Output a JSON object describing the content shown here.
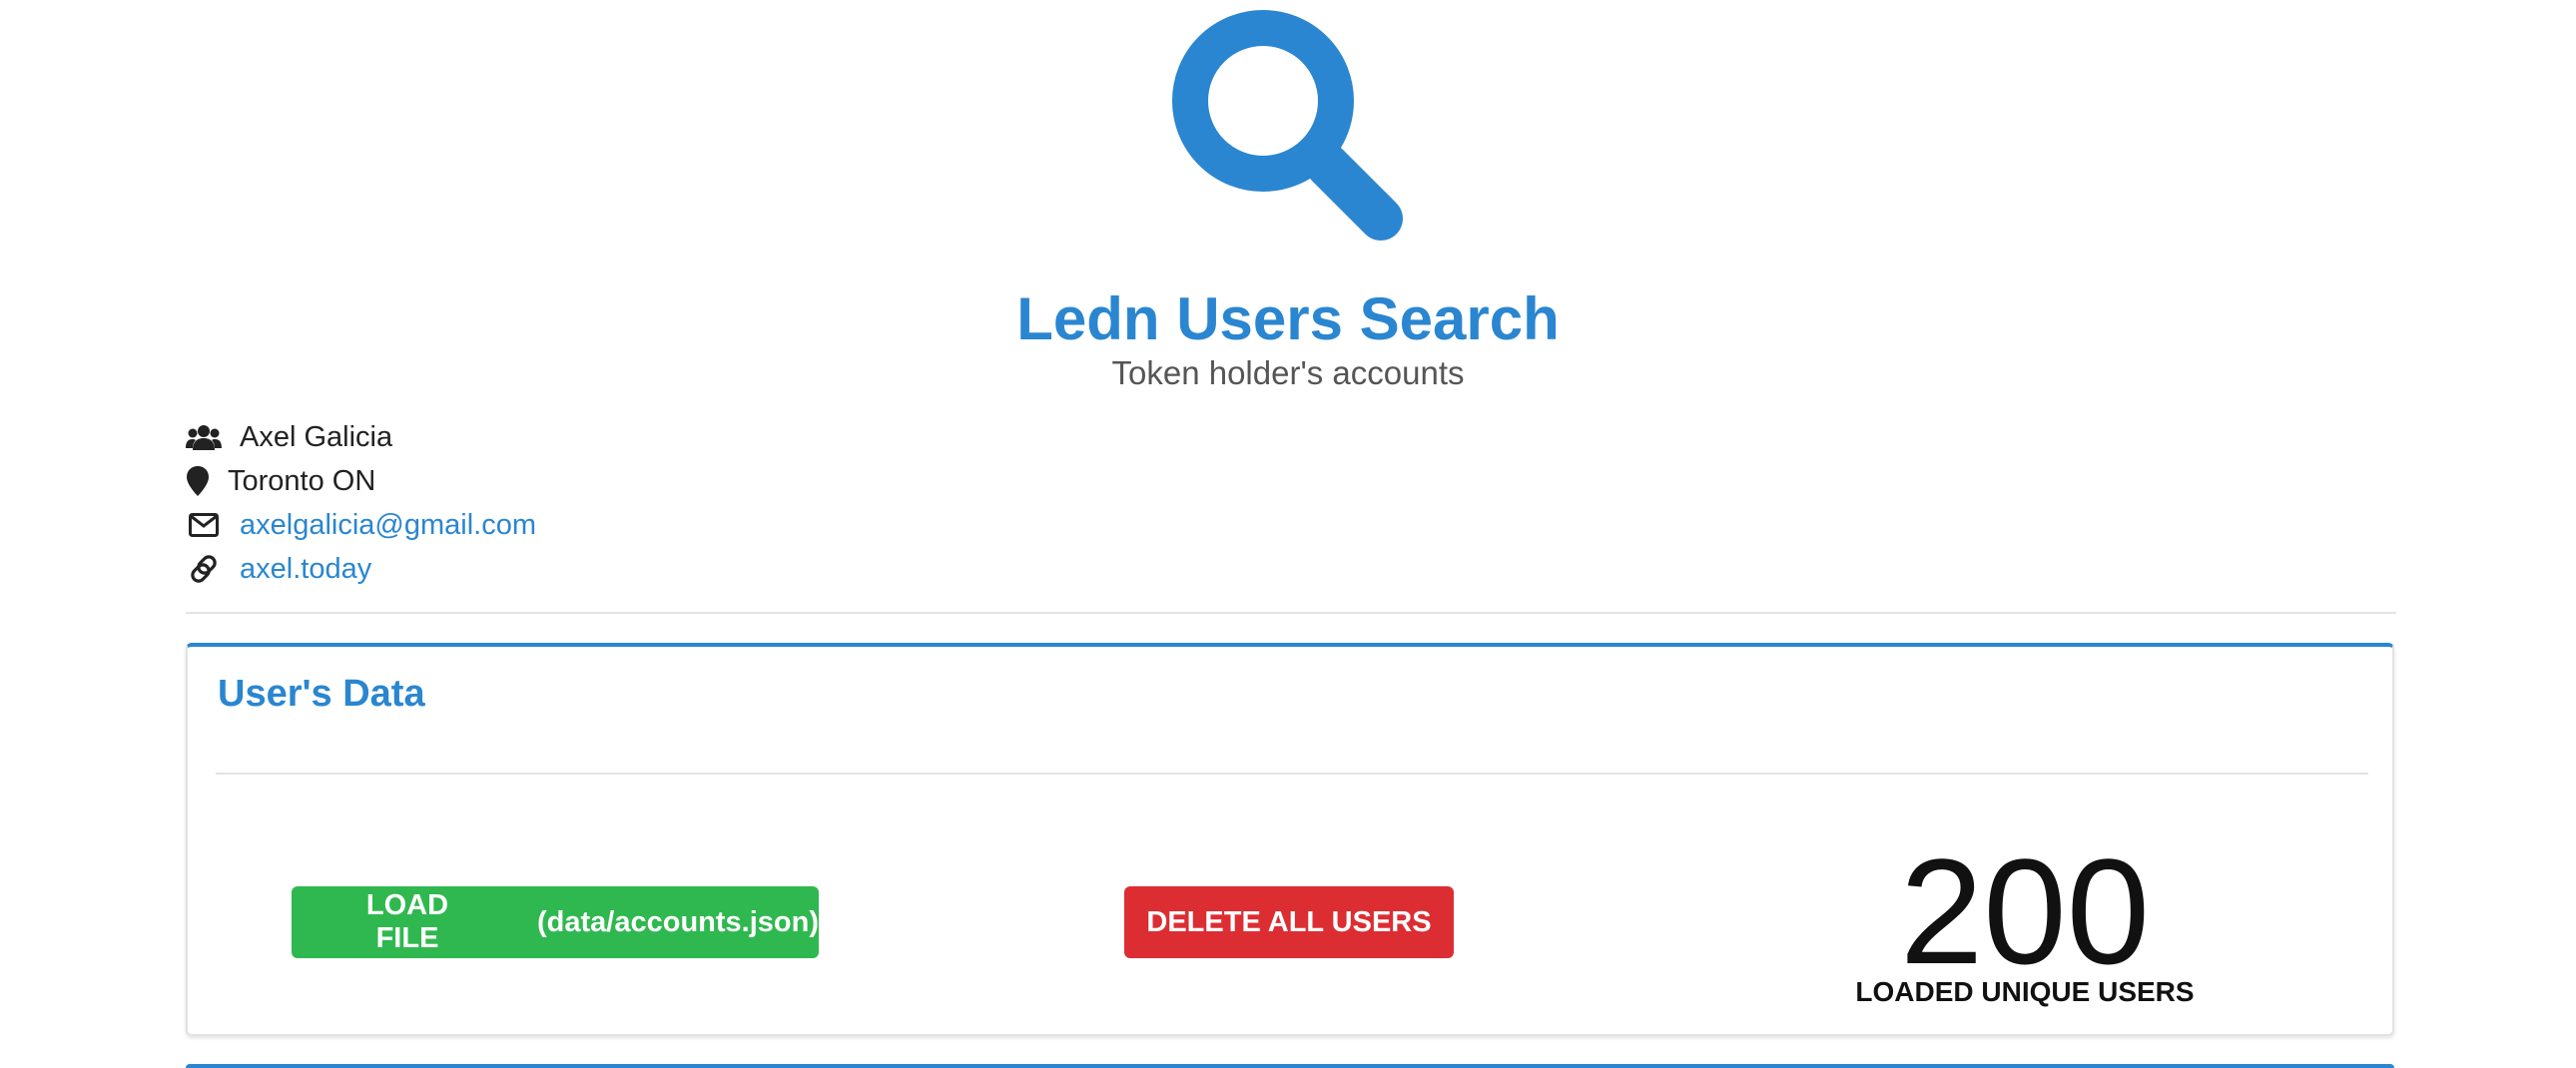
{
  "header": {
    "logo_icon": "magnifier-icon",
    "title": "Ledn Users Search",
    "subtitle": "Token holder's accounts"
  },
  "profile": {
    "name": "Axel Galicia",
    "location": "Toronto ON",
    "email": "axelgalicia@gmail.com",
    "website": "axel.today",
    "icons": {
      "name": "users-icon",
      "location": "map-marker-icon",
      "email": "envelope-icon",
      "website": "link-icon"
    }
  },
  "users_card": {
    "title": "User's Data",
    "load_button_label": "LOAD FILE",
    "load_button_path": "(data/accounts.json)",
    "delete_button_label": "DELETE ALL USERS",
    "count": "200",
    "count_label": "LOADED UNIQUE USERS"
  },
  "colors": {
    "accent": "#2a86d0",
    "success": "#2fb84f",
    "danger": "#dc2d33"
  }
}
